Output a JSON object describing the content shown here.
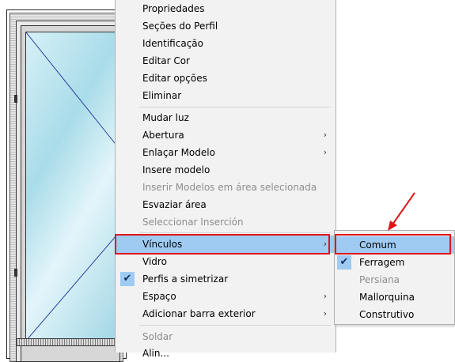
{
  "menu": {
    "items": [
      {
        "label": "Propriedades"
      },
      {
        "label": "Seções do Perfil"
      },
      {
        "label": "Identificação"
      },
      {
        "label": "Editar Cor"
      },
      {
        "label": "Editar opções"
      },
      {
        "label": "Eliminar"
      },
      {
        "label": "Mudar luz"
      },
      {
        "label": "Abertura"
      },
      {
        "label": "Enlaçar Modelo"
      },
      {
        "label": "Insere modelo"
      },
      {
        "label": "Inserir Modelos em área selecionada"
      },
      {
        "label": "Esvaziar área"
      },
      {
        "label": "Seleccionar Inserción"
      },
      {
        "label": "Vínculos"
      },
      {
        "label": "Vidro"
      },
      {
        "label": "Perfis a simetrizar"
      },
      {
        "label": "Espaço"
      },
      {
        "label": "Adicionar barra exterior"
      },
      {
        "label": "Soldar"
      },
      {
        "label": "Alin..."
      }
    ]
  },
  "submenu": {
    "items": [
      {
        "label": "Comum"
      },
      {
        "label": "Ferragem"
      },
      {
        "label": "Persiana"
      },
      {
        "label": "Mallorquina"
      },
      {
        "label": "Construtivo"
      }
    ]
  },
  "icons": {
    "submenu_arrow": "chevron-right-icon",
    "check": "checkmark-icon"
  },
  "colors": {
    "highlight": "#9fcbf3",
    "annotation": "#e01515",
    "menu_bg": "#f2f2f2"
  }
}
